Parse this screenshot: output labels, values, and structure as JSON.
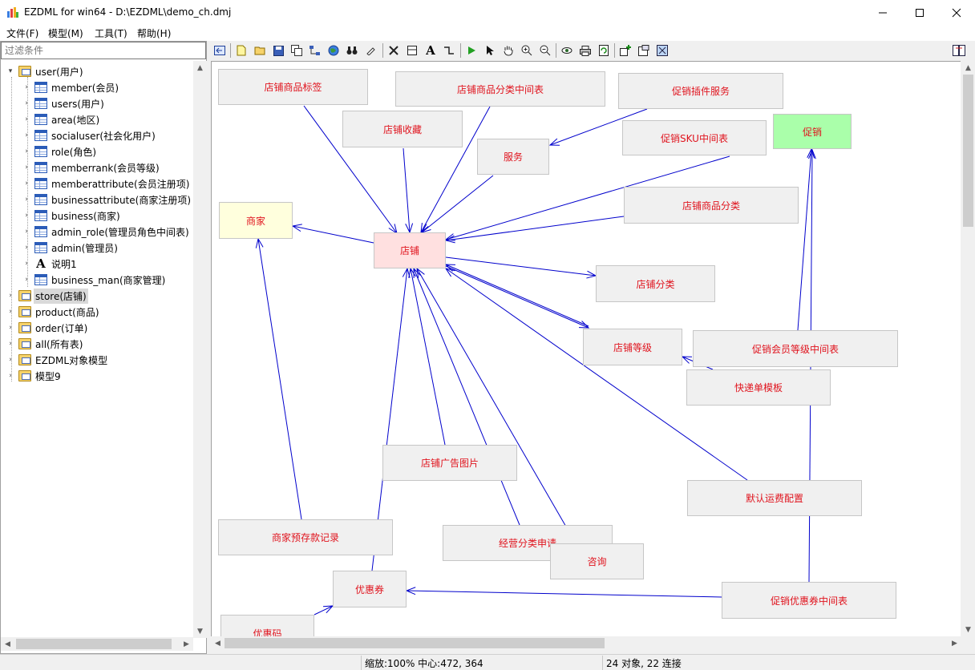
{
  "window": {
    "title": "EZDML for win64 - D:\\EZDML\\demo_ch.dmj"
  },
  "menu": [
    "文件(F)",
    "模型(M)",
    "工具(T)",
    "帮助(H)"
  ],
  "filter": {
    "placeholder": "过滤条件"
  },
  "tree": {
    "root": "user(用户)",
    "children": [
      {
        "label": "member(会员)",
        "icon": "table-icon"
      },
      {
        "label": "users(用户)",
        "icon": "table-icon"
      },
      {
        "label": "area(地区)",
        "icon": "table-icon"
      },
      {
        "label": "socialuser(社会化用户)",
        "icon": "table-icon"
      },
      {
        "label": "role(角色)",
        "icon": "table-icon"
      },
      {
        "label": "memberrank(会员等级)",
        "icon": "table-icon"
      },
      {
        "label": "memberattribute(会员注册项)",
        "icon": "table-icon"
      },
      {
        "label": "businessattribute(商家注册项)",
        "icon": "table-icon"
      },
      {
        "label": "business(商家)",
        "icon": "table-icon"
      },
      {
        "label": "admin_role(管理员角色中间表)",
        "icon": "table-icon"
      },
      {
        "label": "admin(管理员)",
        "icon": "table-icon"
      },
      {
        "label": "说明1",
        "icon": "text-icon"
      },
      {
        "label": "business_man(商家管理)",
        "icon": "table-icon"
      }
    ],
    "folders": [
      "store(店铺)",
      "product(商品)",
      "order(订单)",
      "all(所有表)",
      "EZDML对象模型",
      "模型9"
    ]
  },
  "diagram": {
    "nodes": [
      {
        "id": "n_tag",
        "label": "店铺商品标签",
        "color": "#f0f0f0"
      },
      {
        "id": "n_catmid",
        "label": "店铺商品分类中间表",
        "color": "#f0f0f0"
      },
      {
        "id": "n_plugin",
        "label": "促销插件服务",
        "color": "#f0f0f0"
      },
      {
        "id": "n_fav",
        "label": "店铺收藏",
        "color": "#f0f0f0"
      },
      {
        "id": "n_skumid",
        "label": "促销SKU中间表",
        "color": "#f0f0f0"
      },
      {
        "id": "n_promo",
        "label": "促销",
        "color": "#aaffaa"
      },
      {
        "id": "n_service",
        "label": "服务",
        "color": "#f0f0f0"
      },
      {
        "id": "n_merchant",
        "label": "商家",
        "color": "#ffffdd"
      },
      {
        "id": "n_store",
        "label": "店铺",
        "color": "#ffe0e0"
      },
      {
        "id": "n_prodcat",
        "label": "店铺商品分类",
        "color": "#f0f0f0"
      },
      {
        "id": "n_storecat",
        "label": "店铺分类",
        "color": "#f0f0f0"
      },
      {
        "id": "n_level",
        "label": "店铺等级",
        "color": "#f0f0f0"
      },
      {
        "id": "n_promolv",
        "label": "促销会员等级中间表",
        "color": "#f0f0f0"
      },
      {
        "id": "n_express",
        "label": "快递单模板",
        "color": "#f0f0f0"
      },
      {
        "id": "n_ad",
        "label": "店铺广告图片",
        "color": "#f0f0f0"
      },
      {
        "id": "n_ship",
        "label": "默认运费配置",
        "color": "#f0f0f0"
      },
      {
        "id": "n_deposit",
        "label": "商家预存款记录",
        "color": "#f0f0f0"
      },
      {
        "id": "n_apply",
        "label": "经营分类申请",
        "color": "#f0f0f0"
      },
      {
        "id": "n_consult",
        "label": "咨询",
        "color": "#f0f0f0"
      },
      {
        "id": "n_coupon",
        "label": "优惠券",
        "color": "#f0f0f0"
      },
      {
        "id": "n_couponmid",
        "label": "促销优惠券中间表",
        "color": "#f0f0f0"
      },
      {
        "id": "n_code",
        "label": "优惠码",
        "color": "#f0f0f0"
      }
    ],
    "line_color": "#0000cc",
    "text_color": "#e0141e"
  },
  "status": {
    "zoom": "缩放:100% 中心:472, 364",
    "counts": "24 对象, 22 连接"
  }
}
